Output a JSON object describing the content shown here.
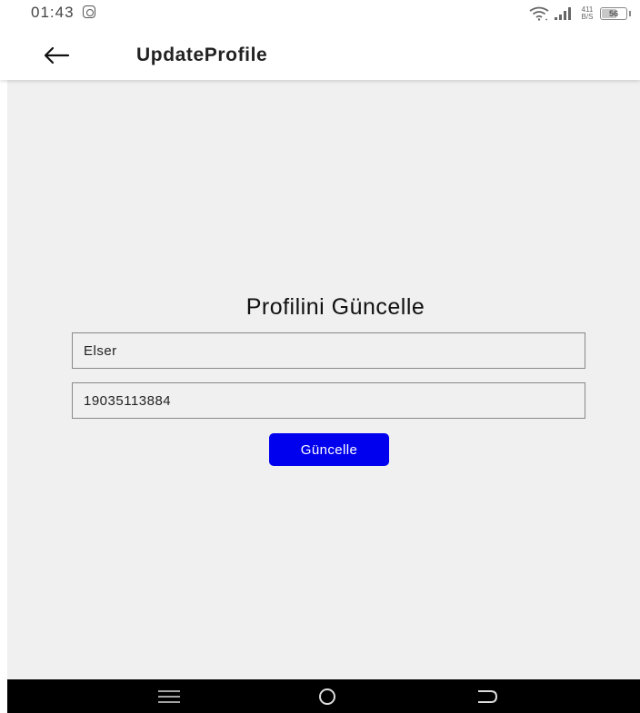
{
  "status_bar": {
    "time": "01:43",
    "net_speed_value": "411",
    "net_speed_unit": "B/S",
    "battery_level": "56"
  },
  "app_bar": {
    "title": "UpdateProfile"
  },
  "main": {
    "heading": "Profilini Güncelle",
    "name_value": "Elser",
    "phone_value": "19035113884",
    "submit_label": "Güncelle"
  },
  "colors": {
    "button": "#0000ee",
    "background": "#f0f0f0",
    "nav_bar": "#000000"
  },
  "icons": {
    "back": "arrow-left-icon",
    "status_app": "instagram-icon",
    "wifi": "wifi-icon",
    "signal": "signal-icon",
    "battery": "battery-icon",
    "nav_menu": "menu-icon",
    "nav_home": "home-icon",
    "nav_back": "back-icon"
  }
}
